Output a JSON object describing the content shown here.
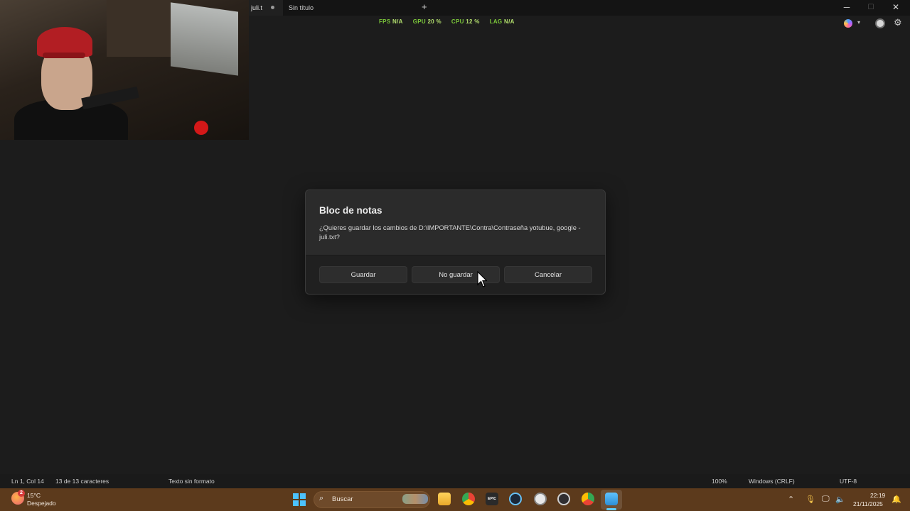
{
  "tabs": [
    {
      "label": "juli.t",
      "modified": true
    },
    {
      "label": "Sin título"
    }
  ],
  "new_tab_icon": "+",
  "window_controls": {
    "minimize": "─",
    "maximize": "☐",
    "close": "✕"
  },
  "overlay_stats": [
    {
      "label": "FPS",
      "value": "N/A"
    },
    {
      "label": "GPU",
      "value": "20 %"
    },
    {
      "label": "CPU",
      "value": "12 %"
    },
    {
      "label": "LAG",
      "value": "N/A"
    }
  ],
  "dialog": {
    "title": "Bloc de notas",
    "message": "¿Quieres guardar los cambios de D:\\IMPORTANTE\\Contra\\Contraseña yotubue, google - juli.txt?",
    "buttons": {
      "save": "Guardar",
      "dont_save": "No guardar",
      "cancel": "Cancelar"
    }
  },
  "statusbar": {
    "position": "Ln 1, Col 14",
    "chars": "13 de 13 caracteres",
    "format": "Texto sin formato",
    "zoom": "100%",
    "line_endings": "Windows (CRLF)",
    "encoding": "UTF-8"
  },
  "taskbar": {
    "weather_badge": "2",
    "weather_temp": "15°C",
    "weather_desc": "Despejado",
    "search_label": "Buscar",
    "epic_label": "EPIC",
    "time": "22:19",
    "date": "21/11/2025"
  },
  "colors": {
    "stats_green": "#7cc83a",
    "taskbar": "#5c3a1c",
    "dialog_bg": "#2b2b2b",
    "editor_bg": "#1c1c1c"
  }
}
